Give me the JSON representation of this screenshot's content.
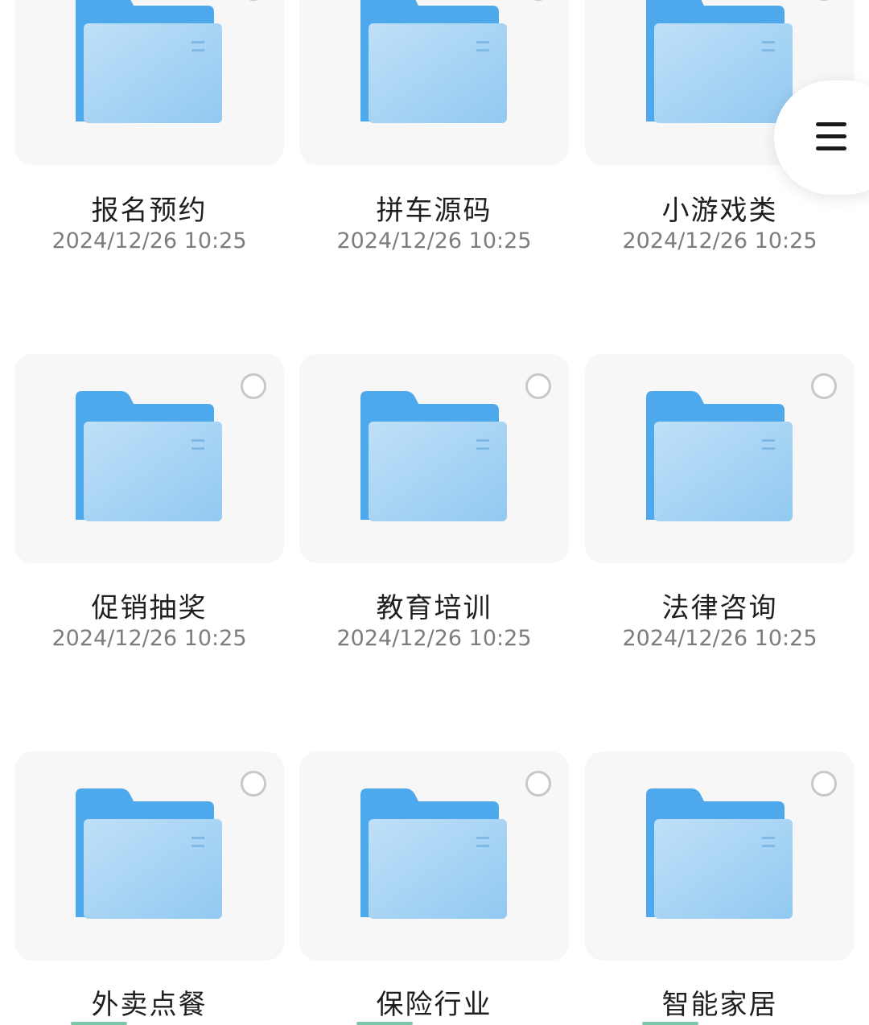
{
  "folders": [
    {
      "name": "报名预约",
      "date": "2024/12/26 10:25"
    },
    {
      "name": "拼车源码",
      "date": "2024/12/26 10:25"
    },
    {
      "name": "小游戏类",
      "date": "2024/12/26 10:25"
    },
    {
      "name": "促销抽奖",
      "date": "2024/12/26 10:25"
    },
    {
      "name": "教育培训",
      "date": "2024/12/26 10:25"
    },
    {
      "name": "法律咨询",
      "date": "2024/12/26 10:25"
    },
    {
      "name": "外卖点餐",
      "date": ""
    },
    {
      "name": "保险行业",
      "date": ""
    },
    {
      "name": "智能家居",
      "date": ""
    }
  ],
  "fab": {
    "icon": "menu-icon"
  },
  "colors": {
    "folder_back": "#4ea9ec",
    "folder_front": "#a6d4f5",
    "card_bg": "#f7f7f7",
    "date_text": "#7d7d7d"
  }
}
